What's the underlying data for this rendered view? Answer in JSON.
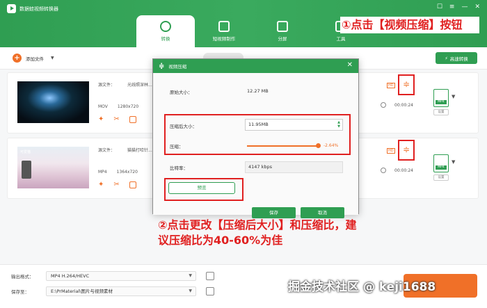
{
  "app": {
    "title": "数据蛙视频转换器",
    "win_feedback": "☐",
    "win_menu": "≡",
    "win_min": "—",
    "win_close": "✕"
  },
  "tabs": [
    {
      "label": "转换",
      "active": true
    },
    {
      "label": "短视频制作",
      "active": false
    },
    {
      "label": "分屏",
      "active": false
    },
    {
      "label": "工具",
      "active": false
    }
  ],
  "toolbar": {
    "add_file": "添加文件",
    "fast_convert": "高速转换"
  },
  "files": [
    {
      "source_label": "源文件：",
      "name": "光线照深林...",
      "format": "MOV",
      "resolution": "1280x720",
      "duration": "00:00:24",
      "output_format": "MP4",
      "settings": "设置"
    },
    {
      "source_label": "源文件：",
      "name": "猫猫打哈针...",
      "format": "MP4",
      "resolution": "1364x720",
      "duration": "00:00:24",
      "output_format": "MP4",
      "settings": "设置",
      "thumb_label": "可爱猫"
    }
  ],
  "bottom": {
    "output_label": "输出格式：",
    "output_value": "MP4 H.264/HEVC",
    "save_label": "保存至：",
    "save_value": "E:\\PrMaterial\\图片与视频素材"
  },
  "dialog": {
    "title": "视频压缩",
    "original_label": "原始大小：",
    "original_value": "12.27 MB",
    "compressed_label": "压缩后大小：",
    "compressed_value": "11.95MB",
    "ratio_label": "压缩：",
    "ratio_value": "-2.64%",
    "ratio_fraction": 0.97,
    "bitrate_label": "比特率：",
    "bitrate_value": "4147 kbps",
    "preview": "预览",
    "save": "保存",
    "cancel": "取消"
  },
  "annotations": {
    "step1": "①点击【视频压缩】按钮",
    "step2": "②点击更改【压缩后大小】和压缩比，建议压缩比为40-60%为佳",
    "watermark": "掘金技术社区 @ keji1688"
  },
  "colors": {
    "green": "#2f9e52",
    "orange": "#f07028",
    "annotation_red": "#e02020"
  }
}
